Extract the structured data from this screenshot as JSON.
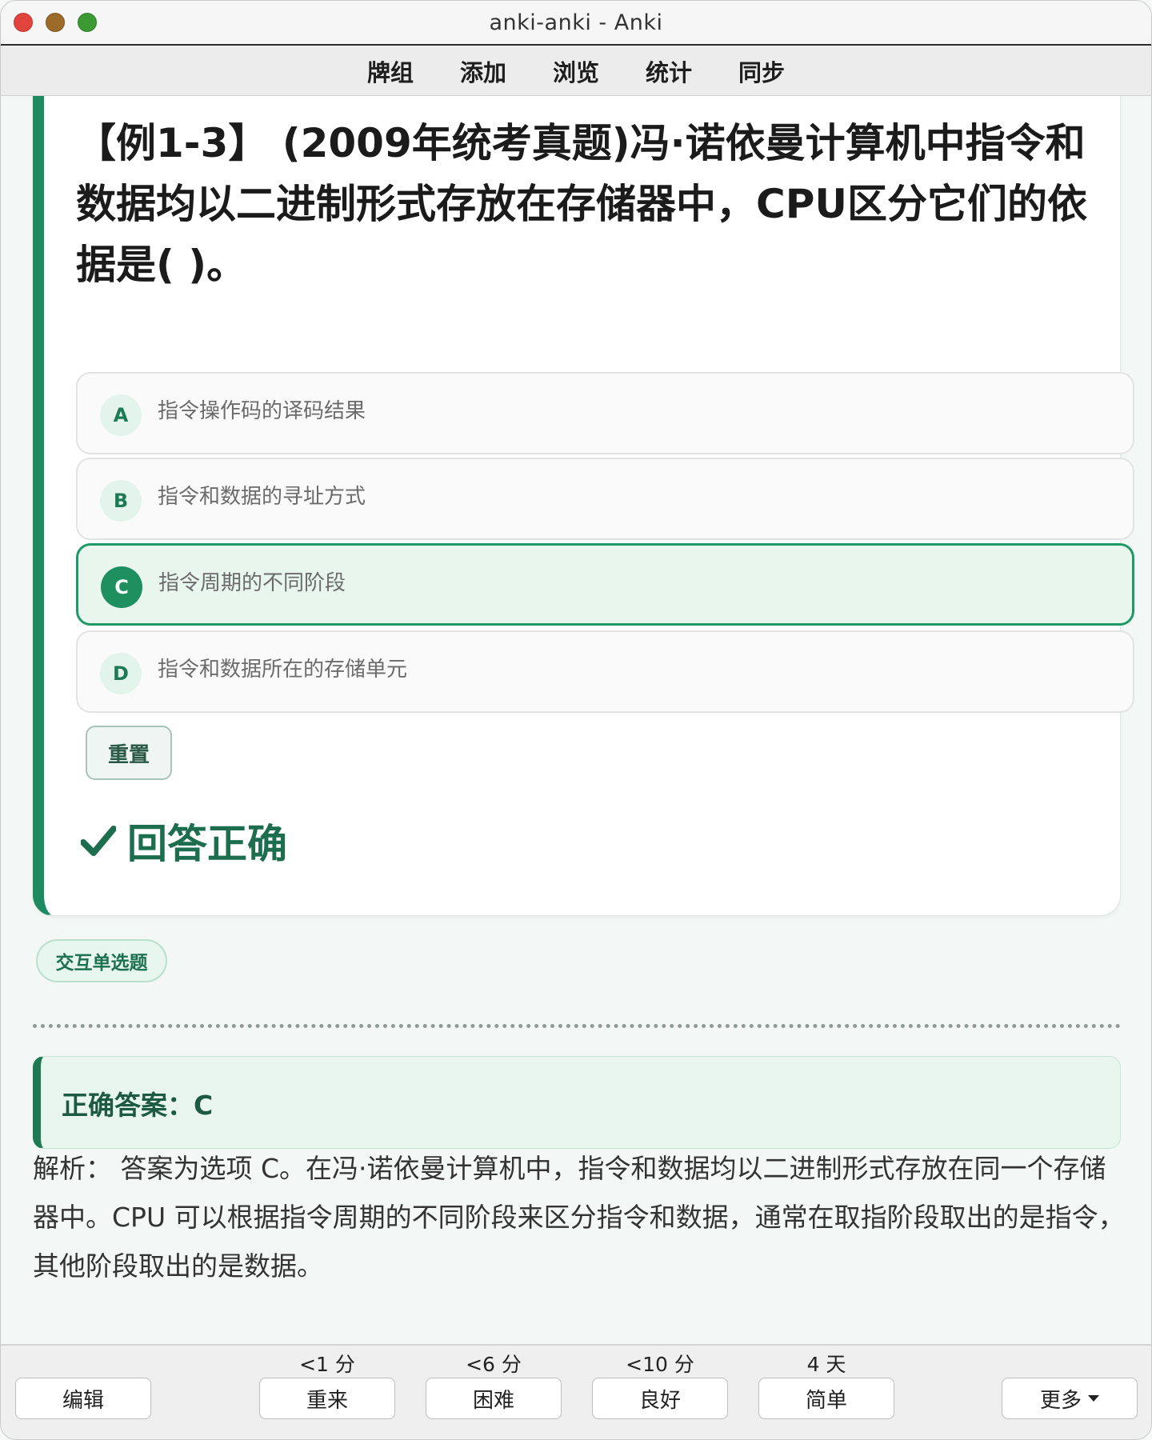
{
  "window": {
    "title": "anki-anki - Anki"
  },
  "menu": {
    "items": [
      "牌组",
      "添加",
      "浏览",
      "统计",
      "同步"
    ]
  },
  "question": {
    "text": "【例1-3】 (2009年统考真题)冯·诺依曼计算机中指令和数据均以二进制形式存放在存储器中，CPU区分它们的依据是( )。"
  },
  "options": [
    {
      "letter": "A",
      "text": "指令操作码的译码结果",
      "selected": false
    },
    {
      "letter": "B",
      "text": "指令和数据的寻址方式",
      "selected": false
    },
    {
      "letter": "C",
      "text": "指令周期的不同阶段",
      "selected": true
    },
    {
      "letter": "D",
      "text": "指令和数据所在的存储单元",
      "selected": false
    }
  ],
  "reset_label": "重置",
  "result": {
    "text": "回答正确",
    "icon": "check-icon",
    "color": "#1d6e4f"
  },
  "tag": "交互单选题",
  "answer": {
    "text": "正确答案：C"
  },
  "explanation": "解析： 答案为选项 C。在冯·诺依曼计算机中，指令和数据均以二进制形式存放在同一个存储器中。CPU 可以根据指令周期的不同阶段来区分指令和数据，通常在取指阶段取出的是指令，其他阶段取出的是数据。",
  "bottom": {
    "edit_label": "编辑",
    "more_label": "更多",
    "answers": [
      {
        "interval": "<1 分",
        "label": "重来"
      },
      {
        "interval": "<6 分",
        "label": "困难"
      },
      {
        "interval": "<10 分",
        "label": "良好"
      },
      {
        "interval": "4 天",
        "label": "简单"
      }
    ]
  },
  "colors": {
    "accent": "#1d8a62",
    "selected_bg": "#e8f6ee"
  }
}
